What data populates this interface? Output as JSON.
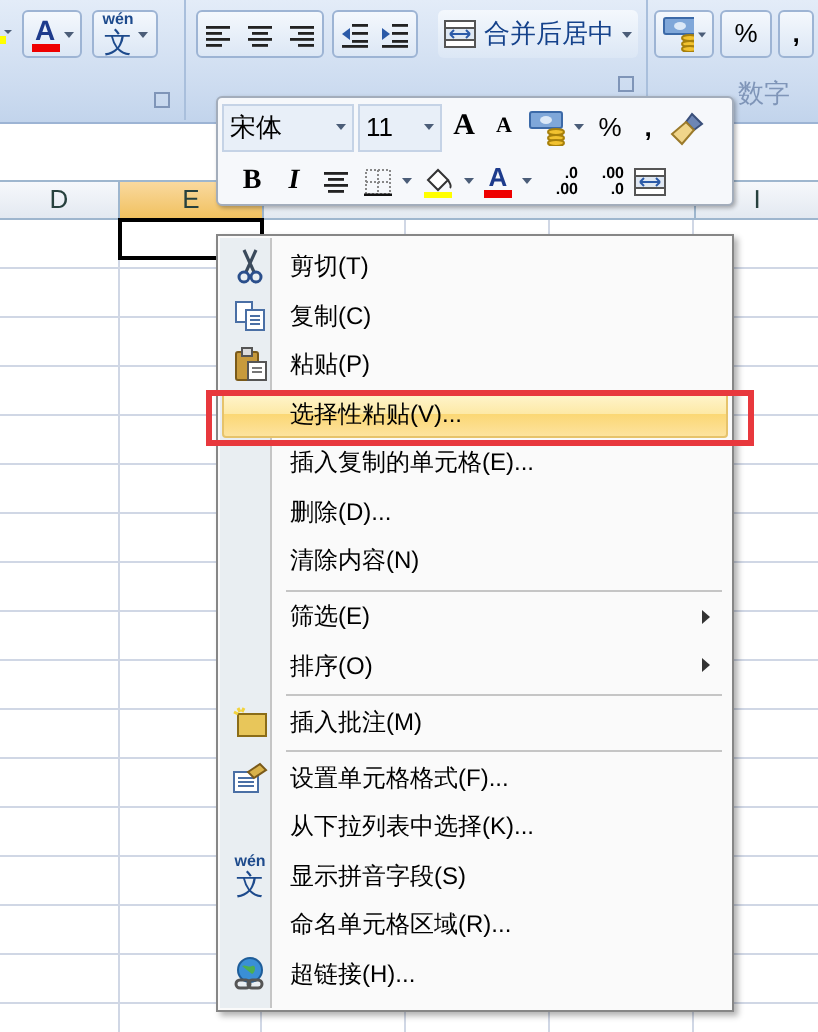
{
  "ribbon": {
    "font_color_button": "A",
    "pinyin_button": [
      "wén",
      "文"
    ],
    "merge_button": "合并后居中",
    "percent_button": "%",
    "comma_button": ",",
    "group_label": "数字"
  },
  "mini_toolbar": {
    "font_field": "宋体",
    "size_field": "11",
    "grow_font": "A",
    "shrink_font": "A",
    "percent": "%",
    "comma": ",",
    "bold": "B",
    "italic": "I",
    "font_color": "A",
    "increase_decimal": [
      ".0",
      ".00"
    ],
    "decrease_decimal": [
      ".00",
      ".0"
    ]
  },
  "sheet": {
    "columns": [
      {
        "label": "D",
        "selected": false
      },
      {
        "label": "E",
        "selected": true
      },
      {
        "label": "I",
        "selected": false
      }
    ]
  },
  "context_menu": [
    {
      "label": "剪切(T)",
      "kind": "item",
      "selected": false,
      "outlined": false,
      "separator_before": false
    },
    {
      "label": "复制(C)",
      "kind": "item",
      "selected": false,
      "outlined": false,
      "separator_before": false
    },
    {
      "label": "粘贴(P)",
      "kind": "item",
      "selected": false,
      "outlined": false,
      "separator_before": false
    },
    {
      "label": "选择性粘贴(V)...",
      "kind": "item",
      "selected": true,
      "outlined": true,
      "separator_before": false
    },
    {
      "label": "插入复制的单元格(E)...",
      "kind": "item",
      "selected": false,
      "outlined": false,
      "separator_before": false
    },
    {
      "label": "删除(D)...",
      "kind": "item",
      "selected": false,
      "outlined": false,
      "separator_before": false
    },
    {
      "label": "清除内容(N)",
      "kind": "item",
      "selected": false,
      "outlined": false,
      "separator_before": false
    },
    {
      "label": "筛选(E)",
      "kind": "submenu",
      "selected": false,
      "outlined": false,
      "separator_before": true
    },
    {
      "label": "排序(O)",
      "kind": "submenu",
      "selected": false,
      "outlined": false,
      "separator_before": false
    },
    {
      "label": "插入批注(M)",
      "kind": "item",
      "selected": false,
      "outlined": false,
      "separator_before": true
    },
    {
      "label": "设置单元格格式(F)...",
      "kind": "item",
      "selected": false,
      "outlined": false,
      "separator_before": true
    },
    {
      "label": "从下拉列表中选择(K)...",
      "kind": "item",
      "selected": false,
      "outlined": false,
      "separator_before": false
    },
    {
      "label": "显示拼音字段(S)",
      "icon_text": [
        "wén",
        "文"
      ],
      "kind": "item",
      "selected": false,
      "outlined": false,
      "separator_before": false
    },
    {
      "label": "命名单元格区域(R)...",
      "kind": "item",
      "selected": false,
      "outlined": false,
      "separator_before": false
    },
    {
      "label": "超链接(H)...",
      "kind": "item",
      "selected": false,
      "outlined": false,
      "separator_before": false
    }
  ]
}
